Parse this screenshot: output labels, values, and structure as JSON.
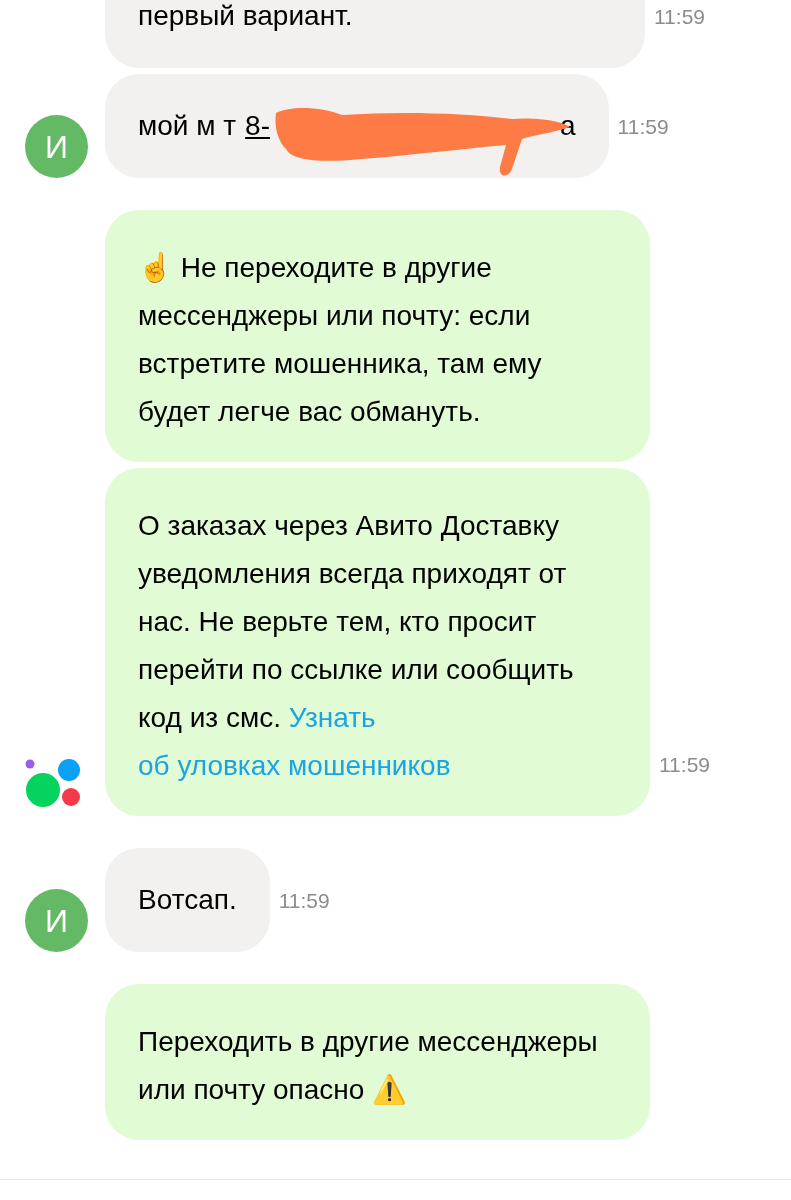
{
  "groups": [
    {
      "avatar": {
        "kind": "letter",
        "text": "И"
      },
      "messages": [
        {
          "kind": "text",
          "system": false,
          "text": "первый вариант.",
          "time": "11:59"
        },
        {
          "kind": "redacted",
          "system": false,
          "text": "мой м т",
          "underlined": "8-",
          "tail": "а",
          "redacted": true,
          "time": "11:59"
        }
      ]
    },
    {
      "avatar": {
        "kind": "logo"
      },
      "messages": [
        {
          "kind": "text",
          "system": true,
          "text": "☝️ Не переходите в другие мессенджеры или почту: если встретите мошенника, там ему будет легче вас обмануть."
        },
        {
          "kind": "text",
          "system": true,
          "text": "О заказах через Авито Доставку уведомления всегда приходят от нас. Не верьте тем, кто просит перейти по ссылке или сообщить код из смс.",
          "links": [
            "Узнать",
            "об уловках мошенников"
          ],
          "time": "11:59"
        }
      ]
    },
    {
      "avatar": {
        "kind": "letter",
        "text": "И"
      },
      "messages": [
        {
          "kind": "text",
          "system": false,
          "text": "Вотсап.",
          "time": "11:59"
        }
      ]
    },
    {
      "messages": [
        {
          "kind": "text",
          "system": true,
          "text": "Переходить в другие мессенджеры или почту опасно ⚠️"
        }
      ]
    }
  ]
}
